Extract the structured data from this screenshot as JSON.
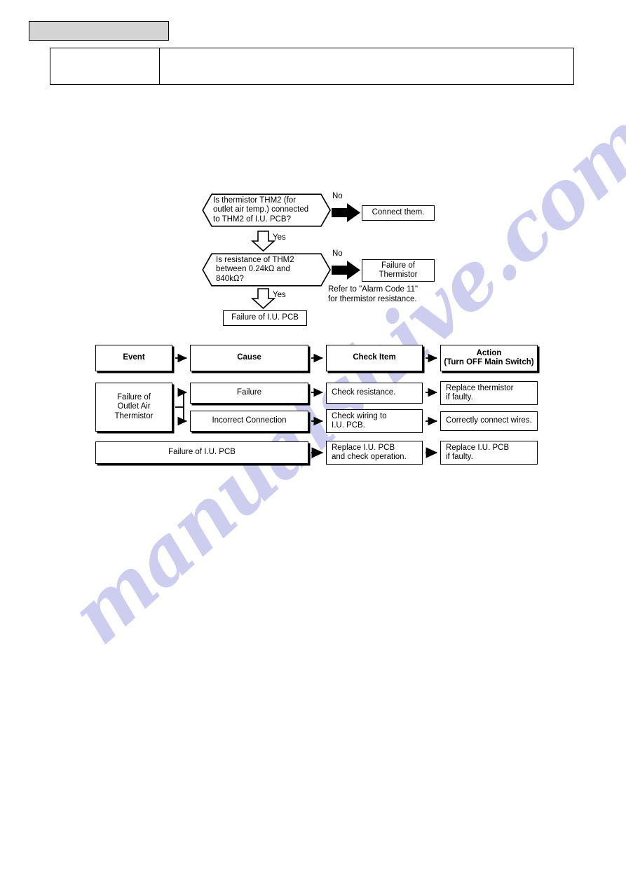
{
  "document": {
    "page_background": "#ffffff",
    "watermark_text": "manualshive.com",
    "watermark_color": "#cdcdf0"
  },
  "header": {
    "badge_label": "",
    "badge_color": "#d4d4d4",
    "table_left_cell": "",
    "table_right_cell": ""
  },
  "flowchart": {
    "decision_1": {
      "text": "Is thermistor THM2 (for\noutlet air temp.) connected\nto THM2 of I.U. PCB?",
      "no_label": "No",
      "yes_label": "Yes",
      "no_result": "Connect them."
    },
    "decision_2": {
      "text": "Is resistance of THM2\nbetween 0.24kΩ and\n840kΩ?",
      "no_label": "No",
      "yes_label": "Yes",
      "no_result": "Failure of\nThermistor",
      "note": "Refer to \"Alarm Code 11\"\nfor thermistor resistance.",
      "yes_result": "Failure of I.U. PCB"
    }
  },
  "table": {
    "headers": [
      {
        "label": "Event"
      },
      {
        "label": "Cause"
      },
      {
        "label": "Check Item"
      },
      {
        "label": "Action\n(Turn OFF Main Switch)"
      }
    ],
    "rows": [
      {
        "event": "Failure of\nOutlet Air\nThermistor",
        "branches": [
          {
            "cause": "Failure",
            "check": "Check resistance.",
            "action": "Replace thermistor\nif faulty."
          },
          {
            "cause": "Incorrect Connection",
            "check": "Check wiring to\nI.U. PCB.",
            "action": "Correctly connect wires."
          }
        ]
      },
      {
        "event": "Failure of I.U. PCB",
        "branches": [
          {
            "cause": "",
            "check": "Replace I.U. PCB\nand check operation.",
            "action": "Replace I.U. PCB\nif faulty."
          }
        ]
      }
    ]
  }
}
